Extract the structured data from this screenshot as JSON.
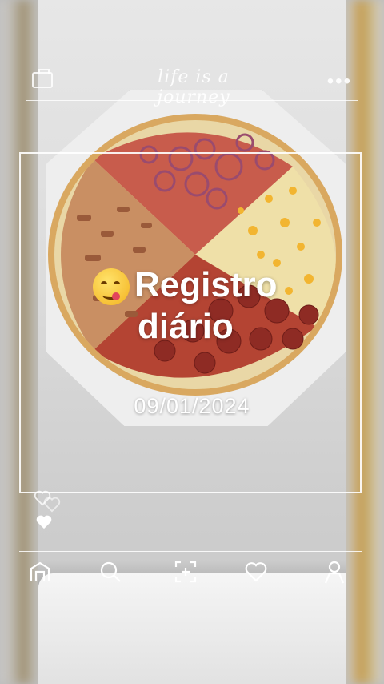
{
  "header": {
    "slogan": "life is a journey",
    "left_icon": "frame-icon",
    "menu_icon": "more-dots-icon",
    "menu_glyph": "•••"
  },
  "card": {
    "emoji": "yum-face-emoji",
    "title_line1": "Registro",
    "title_line2": "diário",
    "date": "09/01/2024"
  },
  "reactions": [
    "heart-outline-icon",
    "heart-filled-icon"
  ],
  "nav": {
    "items": [
      {
        "icon": "home-icon"
      },
      {
        "icon": "search-icon"
      },
      {
        "icon": "scan-add-icon"
      },
      {
        "icon": "heart-icon"
      },
      {
        "icon": "profile-icon"
      }
    ]
  },
  "colors": {
    "overlay_text": "#ffffff",
    "crust": "#d8a45c",
    "pepperoni": "#a8392e",
    "onion": "#9a4b6e",
    "corn": "#f2b531"
  }
}
